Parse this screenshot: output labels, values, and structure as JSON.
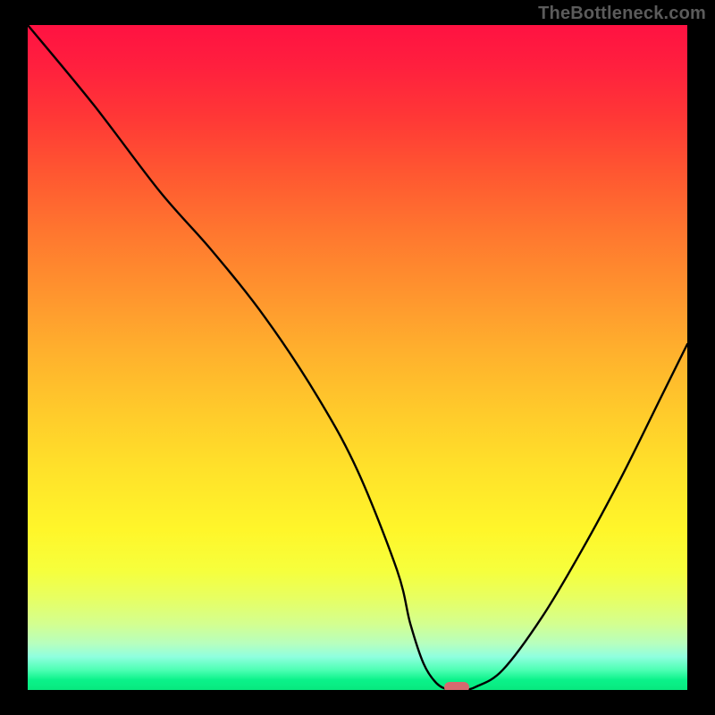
{
  "watermark": "TheBottleneck.com",
  "chart_data": {
    "type": "line",
    "title": "",
    "xlabel": "",
    "ylabel": "",
    "xlim": [
      0,
      100
    ],
    "ylim": [
      0,
      100
    ],
    "grid": false,
    "x": [
      0,
      10,
      20,
      28,
      36,
      44,
      50,
      56,
      58,
      60,
      62,
      64,
      66,
      68,
      72,
      78,
      84,
      90,
      96,
      100
    ],
    "values": [
      100,
      88,
      75,
      66,
      56,
      44,
      33,
      18,
      10,
      4,
      1,
      0,
      0,
      0.5,
      3,
      11,
      21,
      32,
      44,
      52
    ],
    "minimum_x": 65,
    "minimum_value": 0,
    "background": "red-green-gradient",
    "marker": {
      "x": 65,
      "y": 0,
      "color": "#d66a6f",
      "shape": "rounded-rect"
    }
  },
  "colors": {
    "frame": "#000000",
    "curve": "#000000",
    "marker": "#d66a6f",
    "watermark": "#5b5b5b"
  }
}
